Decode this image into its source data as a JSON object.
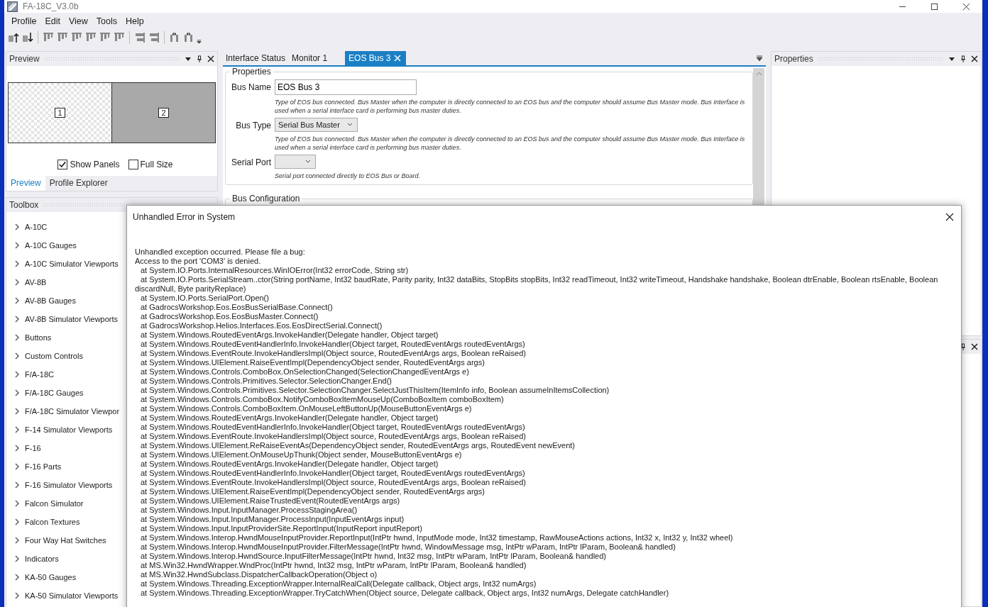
{
  "window": {
    "title": "FA-18C_V3.0b"
  },
  "menu": [
    "Profile",
    "Edit",
    "View",
    "Tools",
    "Help"
  ],
  "preview": {
    "title": "Preview",
    "panels": [
      "1",
      "2"
    ],
    "options": [
      {
        "label": "Show Panels",
        "checked": true
      },
      {
        "label": "Full Size",
        "checked": false
      }
    ],
    "tabs": [
      {
        "label": "Preview",
        "selected": true
      },
      {
        "label": "Profile Explorer",
        "selected": false
      }
    ]
  },
  "toolbox": {
    "title": "Toolbox",
    "items": [
      "A-10C",
      "A-10C Gauges",
      "A-10C Simulator Viewports",
      "AV-8B",
      "AV-8B Gauges",
      "AV-8B Simulator Viewports",
      "Buttons",
      "Custom Controls",
      "F/A-18C",
      "F/A-18C Gauges",
      "F/A-18C Simulator Viewpor",
      "F-14 Simulator Viewports",
      "F-16",
      "F-16 Parts",
      "F-16 Simulator Viewports",
      "Falcon Simulator",
      "Falcon Textures",
      "Four Way Hat Switches",
      "Indicators",
      "KA-50 Gauges",
      "KA-50 Simulator Viewports"
    ]
  },
  "document_tabs": [
    {
      "label": "Interface Status",
      "selected": false
    },
    {
      "label": "Monitor 1",
      "selected": false
    },
    {
      "label": "EOS Bus 3",
      "selected": true
    }
  ],
  "properties_group": {
    "title": "Properties",
    "fields": [
      {
        "kind": "text",
        "label": "Bus Name",
        "value": "EOS Bus 3",
        "help": "Type of EOS bus connected. Bus Master when the computer is directly connected to an EOS bus and the computer should assume Bus Master mode. Bus Interface is used when a serial interface card is performing bus master duties."
      },
      {
        "kind": "select",
        "label": "Bus Type",
        "value": "Serial Bus Master",
        "help": "Type of EOS bus connected. Bus Master when the computer is directly connected to an EOS bus and the computer should assume Bus Master mode. Bus Interface is used when a serial interface card is performing bus master duties."
      },
      {
        "kind": "select",
        "label": "Serial Port",
        "help": "Serial port connected directly to EOS Bus or Board."
      }
    ]
  },
  "bus_configuration": {
    "title": "Bus Configuration"
  },
  "properties_panel": {
    "title": "Properties"
  },
  "dialog": {
    "title": "Unhandled Error in System",
    "lines": [
      {
        "kind": "message",
        "text": "Unhandled exception occurred.  Please file a bug:"
      },
      {
        "kind": "message",
        "text": "Access to the port 'COM3' is denied."
      },
      {
        "kind": "frame",
        "text": "at System.IO.Ports.InternalResources.WinIOError(Int32 errorCode, String str)"
      },
      {
        "kind": "frame",
        "text": "at System.IO.Ports.SerialStream..ctor(String portName, Int32 baudRate, Parity parity, Int32 dataBits, StopBits stopBits, Int32 readTimeout, Int32 writeTimeout, Handshake handshake, Boolean dtrEnable, Boolean rtsEnable, Boolean discardNull, Byte parityReplace)"
      },
      {
        "kind": "frame",
        "text": "at System.IO.Ports.SerialPort.Open()"
      },
      {
        "kind": "frame",
        "text": "at GadrocsWorkshop.Eos.EosBusSerialBase.Connect()"
      },
      {
        "kind": "frame",
        "text": "at GadrocsWorkshop.Eos.EosBusMaster.Connect()"
      },
      {
        "kind": "frame",
        "text": "at GadrocsWorkshop.Helios.Interfaces.Eos.EosDirectSerial.Connect()"
      },
      {
        "kind": "frame",
        "text": "at System.Windows.RoutedEventArgs.InvokeHandler(Delegate handler, Object target)"
      },
      {
        "kind": "frame",
        "text": "at System.Windows.RoutedEventHandlerInfo.InvokeHandler(Object target, RoutedEventArgs routedEventArgs)"
      },
      {
        "kind": "frame",
        "text": "at System.Windows.EventRoute.InvokeHandlersImpl(Object source, RoutedEventArgs args, Boolean reRaised)"
      },
      {
        "kind": "frame",
        "text": "at System.Windows.UIElement.RaiseEventImpl(DependencyObject sender, RoutedEventArgs args)"
      },
      {
        "kind": "frame",
        "text": "at System.Windows.Controls.ComboBox.OnSelectionChanged(SelectionChangedEventArgs e)"
      },
      {
        "kind": "frame",
        "text": "at System.Windows.Controls.Primitives.Selector.SelectionChanger.End()"
      },
      {
        "kind": "frame",
        "text": "at System.Windows.Controls.Primitives.Selector.SelectionChanger.SelectJustThisItem(ItemInfo info, Boolean assumeInItemsCollection)"
      },
      {
        "kind": "frame",
        "text": "at System.Windows.Controls.ComboBox.NotifyComboBoxItemMouseUp(ComboBoxItem comboBoxItem)"
      },
      {
        "kind": "frame",
        "text": "at System.Windows.Controls.ComboBoxItem.OnMouseLeftButtonUp(MouseButtonEventArgs e)"
      },
      {
        "kind": "frame",
        "text": "at System.Windows.RoutedEventArgs.InvokeHandler(Delegate handler, Object target)"
      },
      {
        "kind": "frame",
        "text": "at System.Windows.RoutedEventHandlerInfo.InvokeHandler(Object target, RoutedEventArgs routedEventArgs)"
      },
      {
        "kind": "frame",
        "text": "at System.Windows.EventRoute.InvokeHandlersImpl(Object source, RoutedEventArgs args, Boolean reRaised)"
      },
      {
        "kind": "frame",
        "text": "at System.Windows.UIElement.ReRaiseEventAs(DependencyObject sender, RoutedEventArgs args, RoutedEvent newEvent)"
      },
      {
        "kind": "frame",
        "text": "at System.Windows.UIElement.OnMouseUpThunk(Object sender, MouseButtonEventArgs e)"
      },
      {
        "kind": "frame",
        "text": "at System.Windows.RoutedEventArgs.InvokeHandler(Delegate handler, Object target)"
      },
      {
        "kind": "frame",
        "text": "at System.Windows.RoutedEventHandlerInfo.InvokeHandler(Object target, RoutedEventArgs routedEventArgs)"
      },
      {
        "kind": "frame",
        "text": "at System.Windows.EventRoute.InvokeHandlersImpl(Object source, RoutedEventArgs args, Boolean reRaised)"
      },
      {
        "kind": "frame",
        "text": "at System.Windows.UIElement.RaiseEventImpl(DependencyObject sender, RoutedEventArgs args)"
      },
      {
        "kind": "frame",
        "text": "at System.Windows.UIElement.RaiseTrustedEvent(RoutedEventArgs args)"
      },
      {
        "kind": "frame",
        "text": "at System.Windows.Input.InputManager.ProcessStagingArea()"
      },
      {
        "kind": "frame",
        "text": "at System.Windows.Input.InputManager.ProcessInput(InputEventArgs input)"
      },
      {
        "kind": "frame",
        "text": "at System.Windows.Input.InputProviderSite.ReportInput(InputReport inputReport)"
      },
      {
        "kind": "frame",
        "text": "at System.Windows.Interop.HwndMouseInputProvider.ReportInput(IntPtr hwnd, InputMode mode, Int32 timestamp, RawMouseActions actions, Int32 x, Int32 y, Int32 wheel)"
      },
      {
        "kind": "frame",
        "text": "at System.Windows.Interop.HwndMouseInputProvider.FilterMessage(IntPtr hwnd, WindowMessage msg, IntPtr wParam, IntPtr lParam, Boolean& handled)"
      },
      {
        "kind": "frame",
        "text": "at System.Windows.Interop.HwndSource.InputFilterMessage(IntPtr hwnd, Int32 msg, IntPtr wParam, IntPtr lParam, Boolean& handled)"
      },
      {
        "kind": "frame",
        "text": "at MS.Win32.HwndWrapper.WndProc(IntPtr hwnd, Int32 msg, IntPtr wParam, IntPtr lParam, Boolean& handled)"
      },
      {
        "kind": "frame",
        "text": "at MS.Win32.HwndSubclass.DispatcherCallbackOperation(Object o)"
      },
      {
        "kind": "frame",
        "text": "at System.Windows.Threading.ExceptionWrapper.InternalRealCall(Delegate callback, Object args, Int32 numArgs)"
      },
      {
        "kind": "frame",
        "text": "at System.Windows.Threading.ExceptionWrapper.TryCatchWhen(Object source, Delegate callback, Object args, Int32 numArgs, Delegate catchHandler)"
      }
    ]
  }
}
